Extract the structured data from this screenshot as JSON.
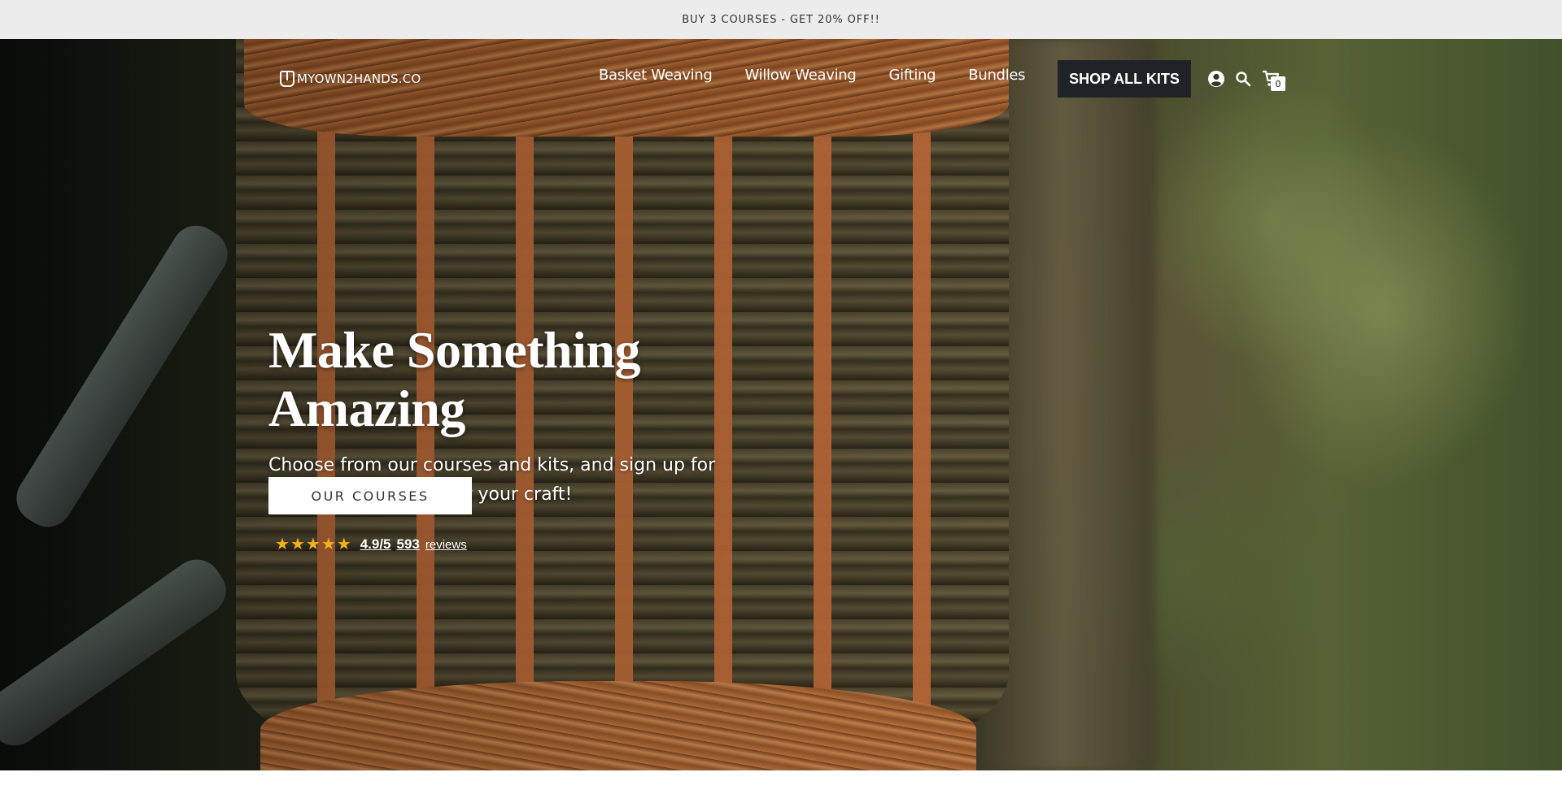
{
  "announcement": {
    "text": "BUY 3 COURSES - GET 20% OFF!!"
  },
  "header": {
    "logo_text": "MYOWN2HANDS.CO",
    "nav": [
      {
        "label": "Basket Weaving"
      },
      {
        "label": "Willow Weaving"
      },
      {
        "label": "Gifting"
      },
      {
        "label": "Bundles"
      }
    ],
    "shop_button": "SHOP ALL KITS",
    "icons": [
      "account-icon",
      "search-icon",
      "cart-icon"
    ],
    "cart_count": "0"
  },
  "hero": {
    "title": "Make Something Amazing",
    "subtitle": "Choose from our courses and kits, and sign up for a free lesson. Discover your craft!",
    "cta": "OUR COURSES",
    "rating": {
      "stars": 5,
      "score": "4.9/5",
      "count": "593",
      "label": "reviews"
    }
  },
  "colors": {
    "announcement_bg": "#ececec",
    "shop_button_bg": "#1f2327",
    "star": "#f2b21a",
    "hero_text": "#ffffff"
  }
}
